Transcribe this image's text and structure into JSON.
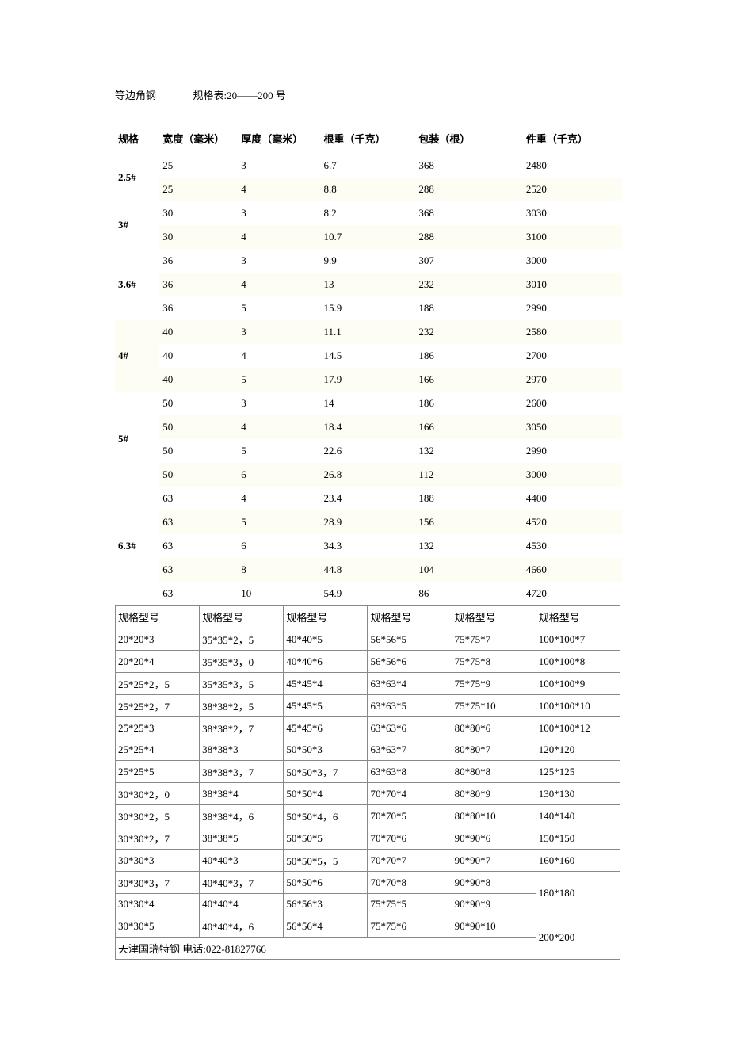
{
  "title_left": "等边角钢",
  "title_right": "规格表:20——200 号",
  "spec_headers": [
    "规格",
    "宽度（毫米）",
    "厚度（毫米）",
    "根重（千克）",
    "包装（根）",
    "件重（千克）"
  ],
  "spec_groups": [
    {
      "label": "2.5#",
      "rows": [
        [
          "25",
          "3",
          "6.7",
          "368",
          "2480"
        ],
        [
          "25",
          "4",
          "8.8",
          "288",
          "2520"
        ]
      ]
    },
    {
      "label": "3#",
      "rows": [
        [
          "30",
          "3",
          "8.2",
          "368",
          "3030"
        ],
        [
          "30",
          "4",
          "10.7",
          "288",
          "3100"
        ]
      ]
    },
    {
      "label": "3.6#",
      "rows": [
        [
          "36",
          "3",
          "9.9",
          "307",
          "3000"
        ],
        [
          "36",
          "4",
          "13",
          "232",
          "3010"
        ],
        [
          "36",
          "5",
          "15.9",
          "188",
          "2990"
        ]
      ]
    },
    {
      "label": "4#",
      "rows": [
        [
          "40",
          "3",
          "11.1",
          "232",
          "2580"
        ],
        [
          "40",
          "4",
          "14.5",
          "186",
          "2700"
        ],
        [
          "40",
          "5",
          "17.9",
          "166",
          "2970"
        ]
      ]
    },
    {
      "label": "5#",
      "rows": [
        [
          "50",
          "3",
          "14",
          "186",
          "2600"
        ],
        [
          "50",
          "4",
          "18.4",
          "166",
          "3050"
        ],
        [
          "50",
          "5",
          "22.6",
          "132",
          "2990"
        ],
        [
          "50",
          "6",
          "26.8",
          "112",
          "3000"
        ]
      ]
    },
    {
      "label": "6.3#",
      "rows": [
        [
          "63",
          "4",
          "23.4",
          "188",
          "4400"
        ],
        [
          "63",
          "5",
          "28.9",
          "156",
          "4520"
        ],
        [
          "63",
          "6",
          "34.3",
          "132",
          "4530"
        ],
        [
          "63",
          "8",
          "44.8",
          "104",
          "4660"
        ],
        [
          "63",
          "10",
          "54.9",
          "86",
          "4720"
        ]
      ]
    }
  ],
  "ref_header": "规格型号",
  "ref_cols": [
    [
      "20*20*3",
      "20*20*4",
      "25*25*2，5",
      "25*25*2，7",
      "25*25*3",
      "25*25*4",
      "25*25*5",
      "30*30*2，0",
      "30*30*2，5",
      "30*30*2，7",
      "30*30*3",
      "30*30*3，7",
      "30*30*4",
      "30*30*5"
    ],
    [
      "35*35*2，5",
      "35*35*3，0",
      "35*35*3，5",
      "38*38*2，5",
      "38*38*2，7",
      "38*38*3",
      "38*38*3，7",
      "38*38*4",
      "38*38*4，6",
      "38*38*5",
      "40*40*3",
      "40*40*3，7",
      "40*40*4",
      "40*40*4，6"
    ],
    [
      "40*40*5",
      "40*40*6",
      "45*45*4",
      "45*45*5",
      "45*45*6",
      "50*50*3",
      "50*50*3，7",
      "50*50*4",
      "50*50*4，6",
      "50*50*5",
      "50*50*5，5",
      "50*50*6",
      "56*56*3",
      "56*56*4"
    ],
    [
      "56*56*5",
      "56*56*6",
      "63*63*4",
      "63*63*5",
      "63*63*6",
      "63*63*7",
      "63*63*8",
      "70*70*4",
      "70*70*5",
      "70*70*6",
      "70*70*7",
      "70*70*8",
      "75*75*5",
      "75*75*6"
    ],
    [
      "75*75*7",
      "75*75*8",
      "75*75*9",
      "75*75*10",
      "80*80*6",
      "80*80*7",
      "80*80*8",
      "80*80*9",
      "80*80*10",
      "90*90*6",
      "90*90*7",
      "90*90*8",
      "90*90*9",
      "90*90*10"
    ],
    [
      "100*100*7",
      "100*100*8",
      "100*100*9",
      "100*100*10",
      "100*100*12",
      "120*120",
      "125*125",
      "130*130",
      "140*140",
      "150*150",
      "160*160",
      "180*180",
      "200*200"
    ]
  ],
  "last_col_spans": [
    1,
    1,
    1,
    1,
    1,
    1,
    1,
    1,
    1,
    1,
    1,
    2,
    2
  ],
  "footer": "天津国瑞特钢 电话:022-81827766"
}
